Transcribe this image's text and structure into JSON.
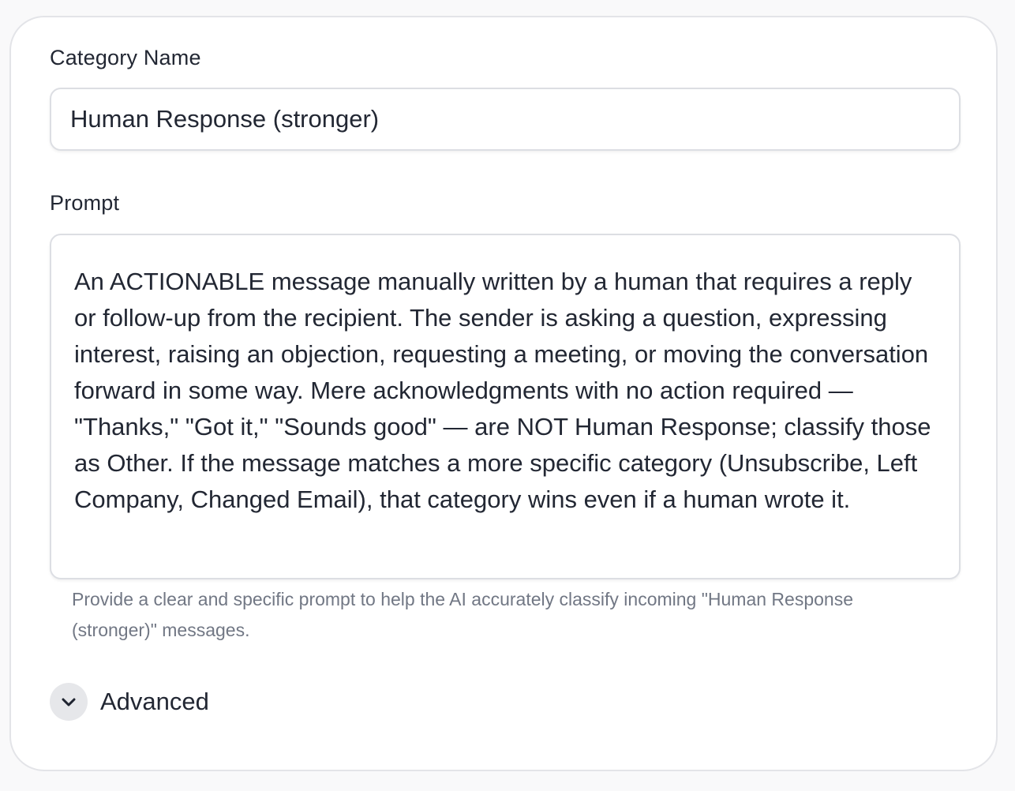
{
  "form": {
    "category_name_label": "Category Name",
    "category_name_value": "Human Response (stronger)",
    "prompt_label": "Prompt",
    "prompt_value": "An ACTIONABLE message manually written by a human that requires a reply or follow-up from the recipient. The sender is asking a question, expressing interest, raising an objection, requesting a meeting, or moving the conversation forward in some way. Mere acknowledgments with no action required — \"Thanks,\" \"Got it,\" \"Sounds good\" — are NOT Human Response; classify those as Other. If the message matches a more specific category (Unsubscribe, Left Company, Changed Email), that category wins even if a human wrote it.",
    "prompt_help": "Provide a clear and specific prompt to help the AI accurately classify incoming \"Human Response (stronger)\" messages.",
    "advanced_label": "Advanced",
    "advanced_icon": "chevron-down-icon"
  },
  "colors": {
    "text": "#222733",
    "help_text": "#717784",
    "border": "#dcdee3",
    "toggle_bg": "#e6e7ea"
  }
}
